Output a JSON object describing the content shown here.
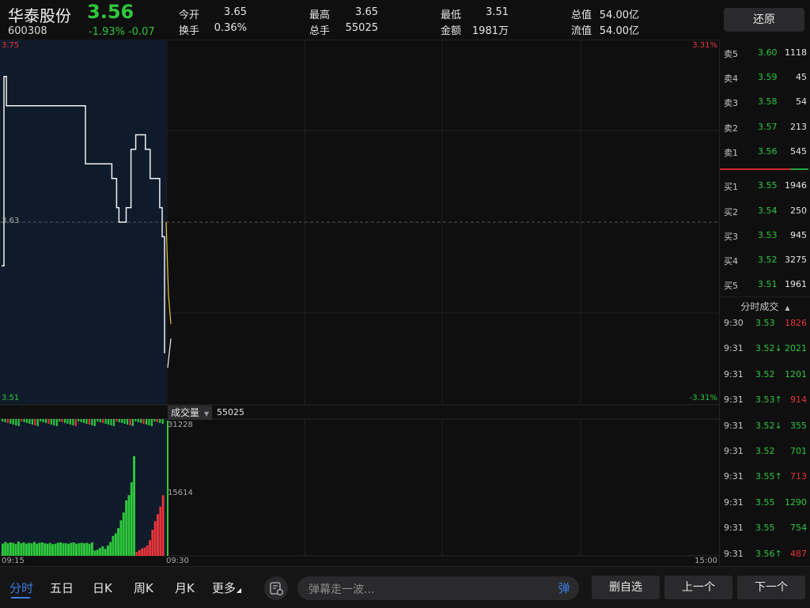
{
  "header": {
    "name": "华泰股份",
    "price": "3.56",
    "code": "600308",
    "pct": "-1.93%",
    "change": "-0.07",
    "stats": [
      {
        "label": "今开",
        "value": "3.65",
        "color": "#e8343a"
      },
      {
        "label": "换手",
        "value": "0.36%",
        "color": "#e6e6e6"
      },
      {
        "label": "最高",
        "value": "3.65",
        "color": "#e8343a"
      },
      {
        "label": "总手",
        "value": "55025",
        "color": "#e6e6e6"
      },
      {
        "label": "最低",
        "value": "3.51",
        "color": "#2ec83c"
      },
      {
        "label": "金额",
        "value": "1981万",
        "color": "#e6e6e6"
      },
      {
        "label": "总值",
        "value": "54.00亿",
        "color": "#e6e6e6"
      },
      {
        "label": "流值",
        "value": "54.00亿",
        "color": "#e6e6e6"
      }
    ],
    "restore_label": "还原"
  },
  "chart": {
    "price_max": "3.75",
    "price_mid": "3.63",
    "price_min": "3.51",
    "pct_max": "3.31%",
    "pct_min": "-3.31%",
    "volume_tab": "成交量",
    "volume_total": "55025",
    "volume_max": "31228",
    "volume_mid": "15614",
    "time_start": "09:15",
    "time_open": "09:30",
    "time_end": "15:00"
  },
  "chart_data": {
    "type": "line",
    "price_axis": [
      3.51,
      3.75
    ],
    "reference_price": 3.63,
    "auction_price_series": [
      3.6,
      3.73,
      3.71,
      3.71,
      3.71,
      3.71,
      3.71,
      3.71,
      3.71,
      3.71,
      3.71,
      3.71,
      3.71,
      3.71,
      3.71,
      3.71,
      3.71,
      3.71,
      3.71,
      3.71,
      3.71,
      3.71,
      3.71,
      3.71,
      3.71,
      3.71,
      3.71,
      3.71,
      3.71,
      3.71,
      3.71,
      3.71,
      3.71,
      3.71,
      3.71,
      3.67,
      3.67,
      3.67,
      3.67,
      3.67,
      3.67,
      3.67,
      3.67,
      3.67,
      3.67,
      3.67,
      3.66,
      3.66,
      3.64,
      3.63,
      3.63,
      3.63,
      3.64,
      3.64,
      3.68,
      3.68,
      3.69,
      3.69,
      3.69,
      3.69,
      3.68,
      3.68,
      3.66,
      3.66,
      3.66,
      3.66,
      3.64,
      3.62,
      3.54
    ],
    "intraday_avg_series": [
      3.63,
      3.58,
      3.56
    ],
    "intraday_price_series": [
      3.53,
      3.55
    ],
    "volume_max": 31228,
    "auction_volumes_green": [
      2800,
      3200,
      2900,
      3100,
      3000,
      2700,
      3300,
      2900,
      3100,
      2800,
      3000,
      2900,
      3200,
      2800,
      3000,
      3100,
      2900,
      2800,
      3000,
      2700,
      2800,
      3000,
      3100,
      2900,
      2900,
      2800,
      3000,
      3100,
      2800,
      2900,
      3000,
      2900,
      3000,
      2800,
      3100,
      1200,
      1400,
      1800,
      2200,
      1600,
      2400,
      3200,
      4600,
      5200,
      6400,
      8200,
      10000,
      12800,
      14000,
      17000,
      23000
    ],
    "auction_volumes_red": [
      900,
      1300,
      1700,
      1900,
      2400,
      3600,
      6000,
      8000,
      9600,
      11400,
      14000
    ],
    "open_volume": 31228
  },
  "order_book": {
    "asks": [
      {
        "label": "卖5",
        "price": "3.60",
        "vol": "1118"
      },
      {
        "label": "卖4",
        "price": "3.59",
        "vol": "45"
      },
      {
        "label": "卖3",
        "price": "3.58",
        "vol": "54"
      },
      {
        "label": "卖2",
        "price": "3.57",
        "vol": "213"
      },
      {
        "label": "卖1",
        "price": "3.56",
        "vol": "545"
      }
    ],
    "bids": [
      {
        "label": "买1",
        "price": "3.55",
        "vol": "1946"
      },
      {
        "label": "买2",
        "price": "3.54",
        "vol": "250"
      },
      {
        "label": "买3",
        "price": "3.53",
        "vol": "945"
      },
      {
        "label": "买4",
        "price": "3.52",
        "vol": "3275"
      },
      {
        "label": "买5",
        "price": "3.51",
        "vol": "1961"
      }
    ],
    "tick_title": "分时成交"
  },
  "ticks": [
    {
      "time": "9:30",
      "price": "3.53",
      "vol": "1826",
      "pcolor": "#2ec83c",
      "vcolor": "#e8343a"
    },
    {
      "time": "9:31",
      "price": "3.52↓",
      "vol": "2021",
      "pcolor": "#2ec83c",
      "vcolor": "#2ec83c"
    },
    {
      "time": "9:31",
      "price": "3.52",
      "vol": "1201",
      "pcolor": "#2ec83c",
      "vcolor": "#2ec83c"
    },
    {
      "time": "9:31",
      "price": "3.53↑",
      "vol": "914",
      "pcolor": "#2ec83c",
      "vcolor": "#e8343a"
    },
    {
      "time": "9:31",
      "price": "3.52↓",
      "vol": "355",
      "pcolor": "#2ec83c",
      "vcolor": "#2ec83c"
    },
    {
      "time": "9:31",
      "price": "3.52",
      "vol": "701",
      "pcolor": "#2ec83c",
      "vcolor": "#2ec83c"
    },
    {
      "time": "9:31",
      "price": "3.55↑",
      "vol": "713",
      "pcolor": "#2ec83c",
      "vcolor": "#e8343a"
    },
    {
      "time": "9:31",
      "price": "3.55",
      "vol": "1290",
      "pcolor": "#2ec83c",
      "vcolor": "#2ec83c"
    },
    {
      "time": "9:31",
      "price": "3.55",
      "vol": "754",
      "pcolor": "#2ec83c",
      "vcolor": "#2ec83c"
    },
    {
      "time": "9:31",
      "price": "3.56↑",
      "vol": "487",
      "pcolor": "#2ec83c",
      "vcolor": "#e8343a"
    }
  ],
  "bottom": {
    "tabs": [
      "分时",
      "五日",
      "日K",
      "周K",
      "月K",
      "更多"
    ],
    "danmu_placeholder": "弹幕走一波...",
    "danmu_send": "弹",
    "remove_fav": "删自选",
    "prev": "上一个",
    "next": "下一个"
  },
  "colors": {
    "up": "#e8343a",
    "down": "#2ec83c",
    "accent": "#3b7de0",
    "auction_bg": "#0f1b2b"
  }
}
